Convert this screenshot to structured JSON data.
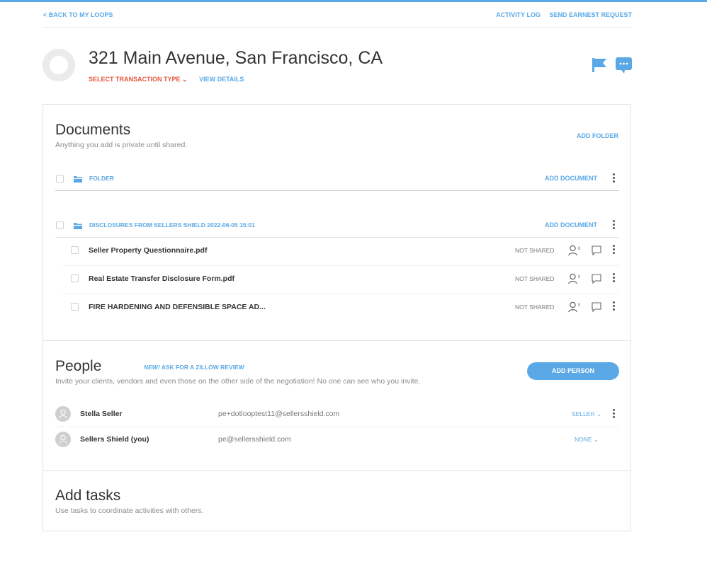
{
  "nav": {
    "back_label": "< BACK TO MY LOOPS",
    "activity_log": "ACTIVITY LOG",
    "send_earnest": "SEND EARNEST REQUEST"
  },
  "header": {
    "address": "321 Main Avenue, San Francisco, CA",
    "select_transaction": "SELECT TRANSACTION TYPE ⌄",
    "view_details": "VIEW DETAILS"
  },
  "documents": {
    "title": "Documents",
    "subtitle": "Anything you add is private until shared.",
    "add_folder": "ADD FOLDER",
    "folders": [
      {
        "name": "FOLDER",
        "add_document": "ADD DOCUMENT"
      },
      {
        "name": "DISCLOSURES FROM SELLERS SHIELD 2022-06-05 15:01",
        "add_document": "ADD DOCUMENT"
      }
    ],
    "files": [
      {
        "name": "Seller Property Questionnaire.pdf",
        "status": "NOT SHARED",
        "shared_count": "0"
      },
      {
        "name": "Real Estate Transfer Disclosure Form.pdf",
        "status": "NOT SHARED",
        "shared_count": "0"
      },
      {
        "name": "FIRE HARDENING AND DEFENSIBLE SPACE AD...",
        "status": "NOT SHARED",
        "shared_count": "0"
      }
    ]
  },
  "people": {
    "title": "People",
    "zillow_new": "NEW!",
    "zillow_text": " ASK FOR A ZILLOW REVIEW",
    "subtitle": "Invite your clients, vendors and even those on the other side of the negotiation! No one can see who you invite.",
    "add_person": "ADD PERSON",
    "rows": [
      {
        "name": "Stella Seller",
        "email": "pe+dotlooptest11@sellersshield.com",
        "role": "SELLER ⌄"
      },
      {
        "name": "Sellers Shield (you)",
        "email": "pe@sellersshield.com",
        "role": "NONE ⌄"
      }
    ]
  },
  "tasks": {
    "title": "Add tasks",
    "subtitle": "Use tasks to coordinate activities with others."
  },
  "colors": {
    "accent": "#5aa9e6",
    "transaction_link": "#e4573d"
  },
  "icons": [
    "flag-icon",
    "chat-icon",
    "folder-icon",
    "person-icon",
    "comment-icon",
    "kebab-menu-icon",
    "user-avatar-icon"
  ]
}
